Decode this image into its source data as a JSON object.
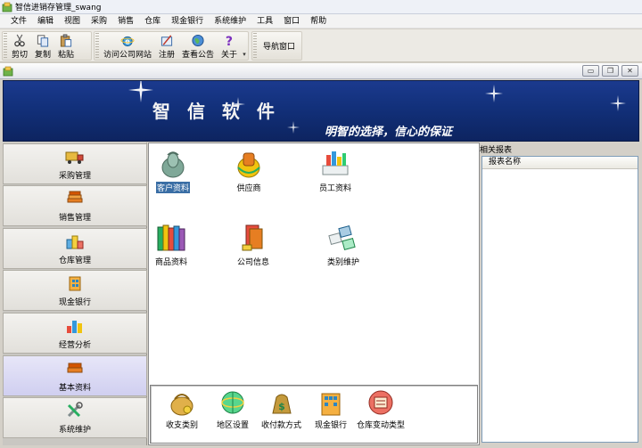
{
  "window": {
    "title": "智信进销存管理_swang"
  },
  "menu": [
    "文件",
    "编辑",
    "视图",
    "采购",
    "销售",
    "仓库",
    "现金银行",
    "系统维护",
    "工具",
    "窗口",
    "帮助"
  ],
  "toolbar": {
    "group1": [
      {
        "label": "剪切",
        "icon": "scissors-icon"
      },
      {
        "label": "复制",
        "icon": "copy-icon"
      },
      {
        "label": "粘贴",
        "icon": "paste-icon"
      }
    ],
    "group2": [
      {
        "label": "访问公司网站",
        "icon": "ie-icon"
      },
      {
        "label": "注册",
        "icon": "register-icon"
      },
      {
        "label": "查看公告",
        "icon": "globe-icon"
      },
      {
        "label": "关于",
        "icon": "help-icon"
      }
    ],
    "nav_window": "导航窗口",
    "more": "▾"
  },
  "child_window": {
    "minimize": "▭",
    "restore": "❐",
    "close": "✕"
  },
  "banner": {
    "brand": "智 信 软 件",
    "slogan": "明智的选择，信心的保证"
  },
  "leftnav": [
    {
      "label": "采购管理",
      "icon": "truck-icon"
    },
    {
      "label": "销售管理",
      "icon": "books-icon"
    },
    {
      "label": "仓库管理",
      "icon": "warehouse-icon"
    },
    {
      "label": "现金银行",
      "icon": "bank-icon"
    },
    {
      "label": "经营分析",
      "icon": "chart-icon"
    },
    {
      "label": "基本资料",
      "icon": "basic-data-icon",
      "active": true
    },
    {
      "label": "系统维护",
      "icon": "tools-icon"
    }
  ],
  "content": {
    "icons": [
      {
        "label": "客户资料",
        "icon": "customer-icon",
        "selected": true
      },
      {
        "label": "供应商",
        "icon": "supplier-icon"
      },
      {
        "label": "员工资料",
        "icon": "staff-icon"
      },
      {
        "label": "商品资料",
        "icon": "product-icon"
      },
      {
        "label": "公司信息",
        "icon": "company-icon"
      },
      {
        "label": "类别维护",
        "icon": "category-icon"
      }
    ],
    "bottom_icons": [
      {
        "label": "收支类别",
        "icon": "purse-icon"
      },
      {
        "label": "地区设置",
        "icon": "region-icon"
      },
      {
        "label": "收付款方式",
        "icon": "money-bag-icon"
      },
      {
        "label": "现金银行",
        "icon": "bank-building-icon"
      },
      {
        "label": "仓库变动类型",
        "icon": "warehouse-change-icon"
      }
    ]
  },
  "right_panel": {
    "title": "相关报表",
    "column_header": "报表名称"
  },
  "colors": {
    "banner": "#12307a",
    "selection": "#3a6ea5",
    "active_nav": "#d0cff0"
  }
}
